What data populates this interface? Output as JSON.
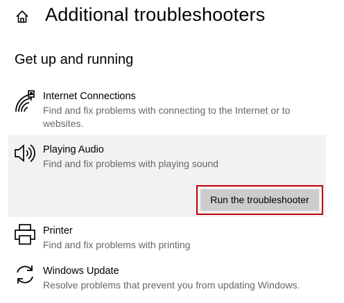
{
  "header": {
    "title": "Additional troubleshooters",
    "home_icon": "home-icon"
  },
  "section": {
    "title": "Get up and running"
  },
  "items": [
    {
      "title": "Internet Connections",
      "description": "Find and fix problems with connecting to the Internet or to websites.",
      "icon": "wifi-network-icon"
    },
    {
      "title": "Playing Audio",
      "description": "Find and fix problems with playing sound",
      "icon": "speaker-icon",
      "selected": true,
      "button_label": "Run the troubleshooter"
    },
    {
      "title": "Printer",
      "description": "Find and fix problems with printing",
      "icon": "printer-icon"
    },
    {
      "title": "Windows Update",
      "description": "Resolve problems that prevent you from updating Windows.",
      "icon": "sync-icon"
    }
  ],
  "colors": {
    "highlight": "#c00000",
    "selected_background": "#f2f2f2",
    "button_background": "#cccccc",
    "description_text": "#666666"
  }
}
